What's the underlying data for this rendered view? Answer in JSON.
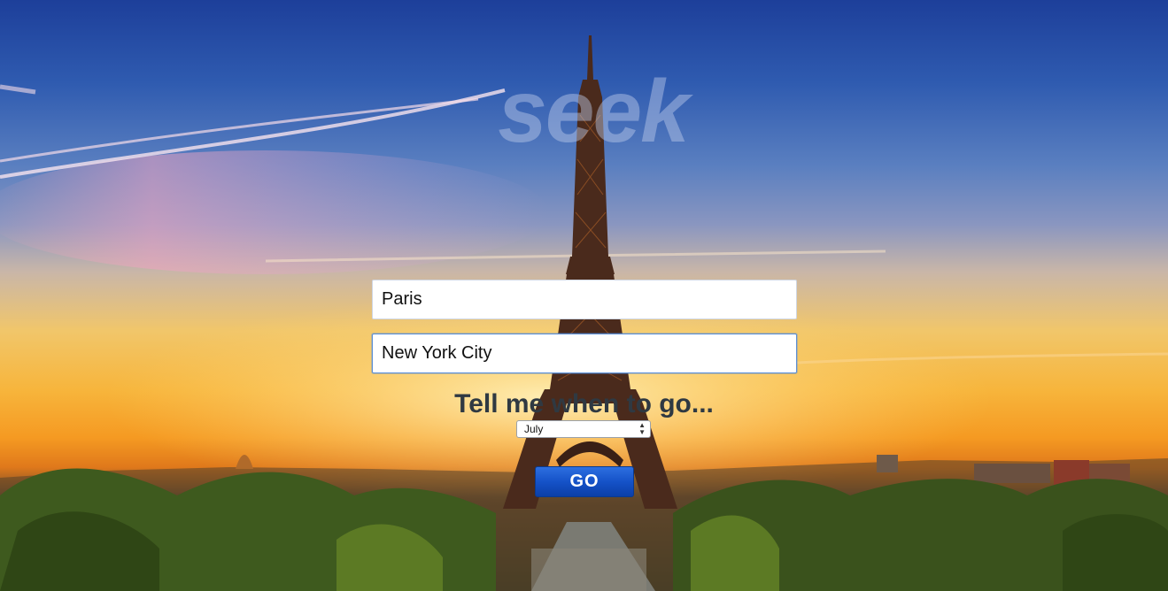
{
  "app": {
    "logo_text": "seek"
  },
  "search": {
    "origin_value": "Paris",
    "destination_value": "New York City"
  },
  "when": {
    "prompt": "Tell me when to go...",
    "selected_month": "July"
  },
  "actions": {
    "go_label": "GO"
  },
  "icons": {
    "select_arrows": "updown-arrows-icon"
  },
  "colors": {
    "button_blue": "#1552c8",
    "prompt_text": "#2f3942",
    "logo_tint": "#becdeb"
  }
}
